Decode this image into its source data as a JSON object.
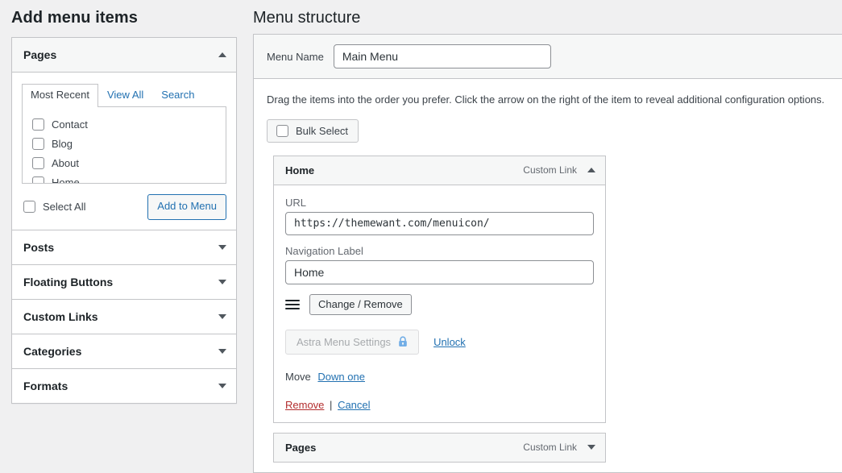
{
  "left_panel": {
    "heading": "Add menu items",
    "accordion": [
      {
        "title": "Pages",
        "open": true,
        "caret": "caret-up-icon",
        "tabs": [
          {
            "label": "Most Recent",
            "active": true
          },
          {
            "label": "View All",
            "active": false
          },
          {
            "label": "Search",
            "active": false
          }
        ],
        "items": [
          {
            "label": "Contact",
            "checked": false
          },
          {
            "label": "Blog",
            "checked": false
          },
          {
            "label": "About",
            "checked": false
          },
          {
            "label": "Home",
            "checked": false
          }
        ],
        "select_all_label": "Select All",
        "add_button_label": "Add to Menu"
      },
      {
        "title": "Posts",
        "open": false,
        "caret": "caret-down-icon"
      },
      {
        "title": "Floating Buttons",
        "open": false,
        "caret": "caret-down-icon"
      },
      {
        "title": "Custom Links",
        "open": false,
        "caret": "caret-down-icon"
      },
      {
        "title": "Categories",
        "open": false,
        "caret": "caret-down-icon"
      },
      {
        "title": "Formats",
        "open": false,
        "caret": "caret-down-icon"
      }
    ]
  },
  "right_panel": {
    "heading": "Menu structure",
    "menu_name": {
      "label": "Menu Name",
      "value": "Main Menu"
    },
    "instructions": "Drag the items into the order you prefer. Click the arrow on the right of the item to reveal additional configuration options.",
    "bulk_select_label": "Bulk Select",
    "menu_items": [
      {
        "title": "Home",
        "type": "Custom Link",
        "expanded": true,
        "caret": "caret-up-icon",
        "url_label": "URL",
        "url_value": "https://themewant.com/menuicon/",
        "nav_label_label": "Navigation Label",
        "nav_label_value": "Home",
        "change_remove_label": "Change / Remove",
        "astra_label": "Astra Menu Settings",
        "unlock_label": "Unlock",
        "move_label": "Move",
        "move_link": "Down one",
        "remove_label": "Remove",
        "separator": "|",
        "cancel_label": "Cancel"
      },
      {
        "title": "Pages",
        "type": "Custom Link",
        "expanded": false,
        "caret": "caret-down-icon"
      }
    ]
  },
  "colors": {
    "accent_blue": "#2271b1",
    "danger_red": "#b32d2e",
    "lock_blue": "#72aee6",
    "page_bg": "#f0f0f1",
    "panel_bg": "#ffffff",
    "header_bg": "#f6f7f7",
    "border": "#c3c4c7",
    "text": "#3c434a"
  }
}
